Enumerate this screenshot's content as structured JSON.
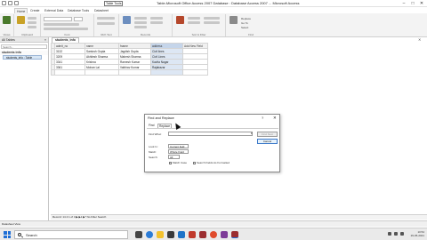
{
  "window": {
    "title": "Table-Microsoft Office Access 2007 Database : Database Access 2007 ... Microsoft Access",
    "tooltip": "Table Tools",
    "controls": [
      "–",
      "□",
      "✕"
    ]
  },
  "ribbon": {
    "tabs": [
      "Home",
      "Create",
      "External Data",
      "Database Tools",
      "Datasheet"
    ],
    "active_tab": "Home",
    "groups": [
      "Views",
      "Clipboard",
      "Font",
      "Rich Text",
      "Records",
      "Sort & Filter",
      "Find"
    ],
    "find_labels": [
      "Replace",
      "Go To",
      "Select"
    ]
  },
  "nav_pane": {
    "header": "All Tables",
    "search_placeholder": "Search...",
    "group": "students info",
    "item": "students_info : Table"
  },
  "datasheet": {
    "doc_tab": "students_info",
    "columns": [
      "admit_no",
      "name",
      "fname",
      "address",
      "Add New Field"
    ],
    "rows": [
      [
        "3132",
        "Santosh Gupta",
        "Jagdish Gupta",
        "Civil lines"
      ],
      [
        "3209",
        "Akhilesh Sharma",
        "Mahesh Sharma",
        "Civil Lines"
      ],
      [
        "3341",
        "Krishna",
        "Ramesh Kumar",
        "Kavita Nagar"
      ],
      [
        "3361",
        "Mohan Lal",
        "Vaibhav Kumar",
        "Rajabazar"
      ]
    ],
    "record_nav": "Record: 14 4 1 of 4 ▶ ▶1 ▶*  No Filter  Search"
  },
  "statusbar": {
    "left": "Datasheet View"
  },
  "dialog": {
    "title": "Find and Replace",
    "help": "?",
    "close": "✕",
    "tabs": [
      "Find",
      "Replace"
    ],
    "active_tab": "Find",
    "find_what_label": "Find What:",
    "find_what_value": "",
    "look_in_label": "Look In:",
    "look_in_value": "Current field",
    "match_label": "Match:",
    "match_value": "Whole Field",
    "search_label": "Search:",
    "search_value": "All",
    "match_case": "Match Case",
    "search_formatted": "Search Fields As Formatted",
    "find_next": "Find Next",
    "cancel": "Cancel"
  },
  "taskbar": {
    "search_placeholder": "Search",
    "time": "10:54",
    "date": "29-05-2021",
    "lang": "ENG"
  },
  "colors": {
    "selected_column": "#dde7f4",
    "accent": "#1f6fd6"
  }
}
